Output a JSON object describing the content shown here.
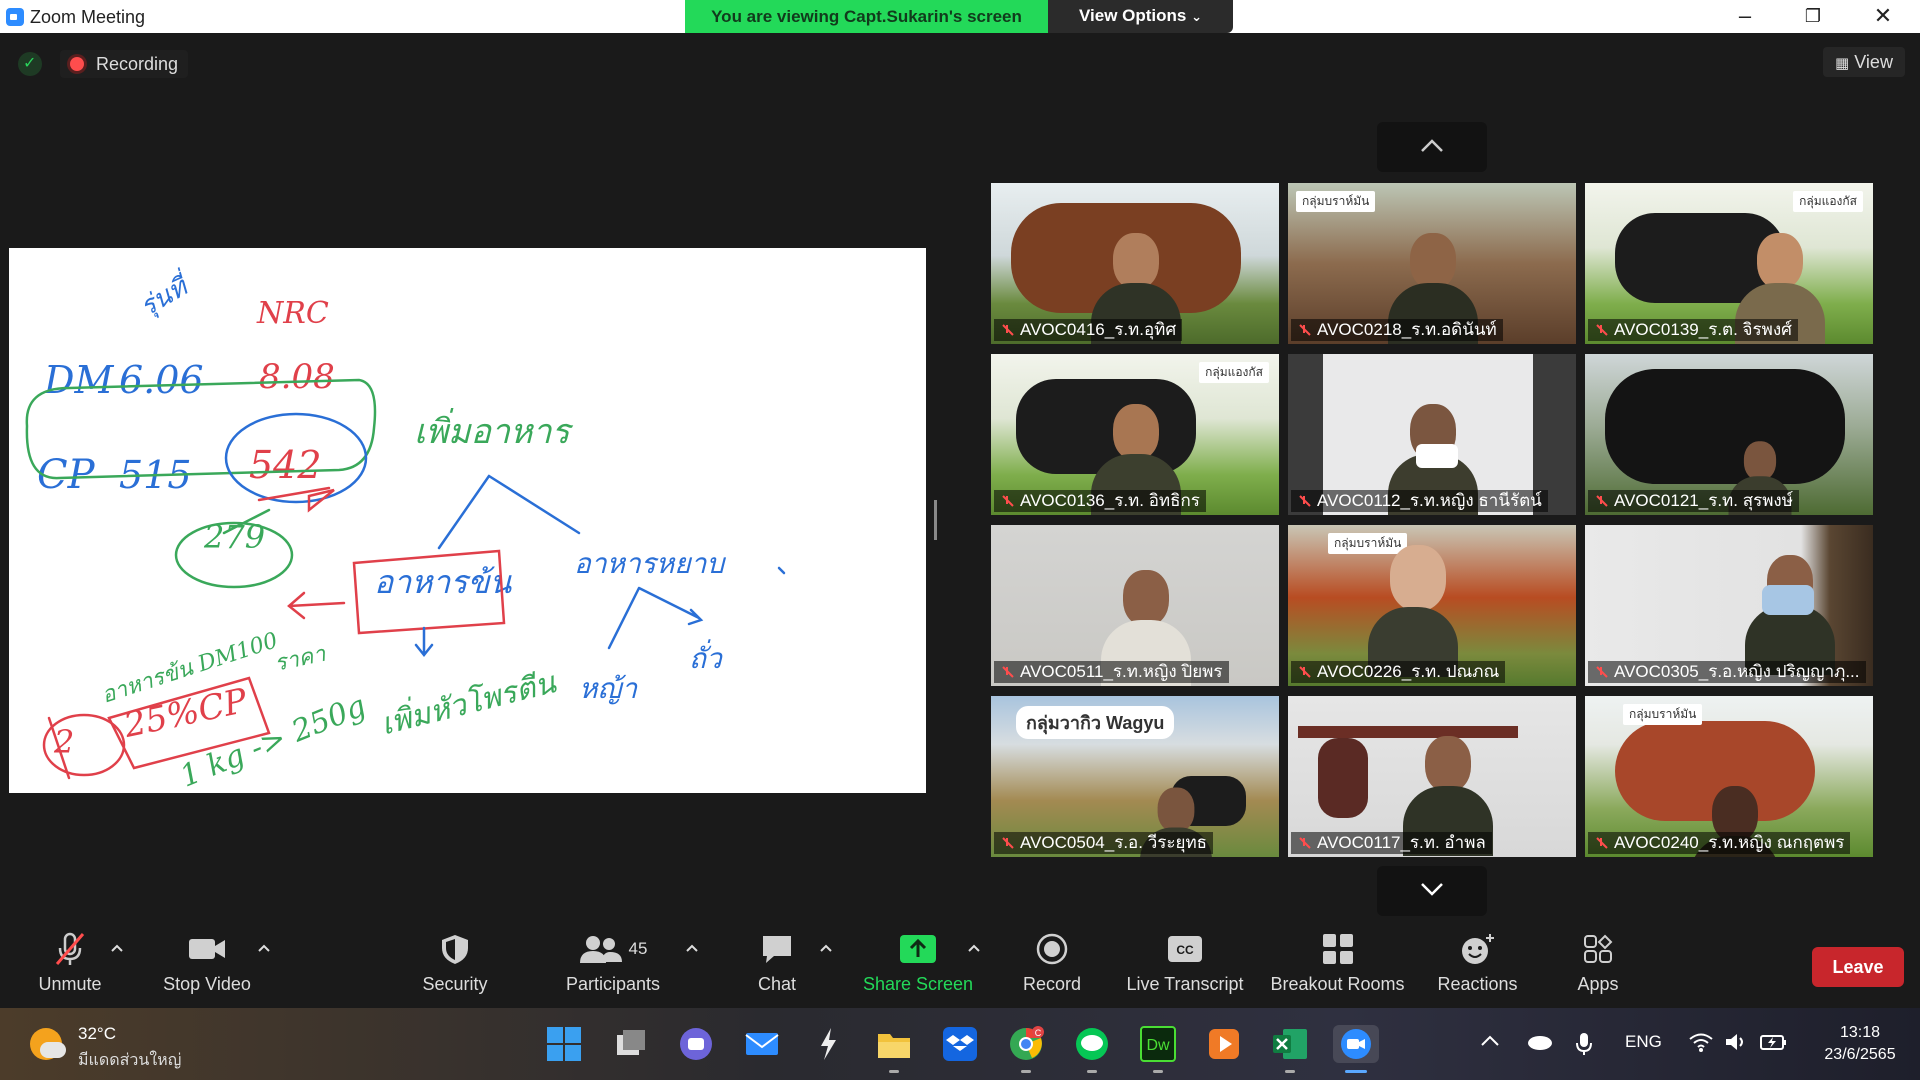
{
  "window": {
    "title": "Zoom Meeting"
  },
  "share_banner": {
    "text": "You are viewing Capt.Sukarin's screen",
    "view_options": "View Options"
  },
  "overlay": {
    "recording": "Recording",
    "view": "View"
  },
  "whiteboard": {
    "lines": [
      "รุ่นที่",
      "NRC",
      "DM",
      "6.06",
      "8.08",
      "CP",
      "515",
      "542",
      "279",
      "เพิ่มอาหาร",
      "อาหารข้น",
      "อาหารหยาบ",
      "อาหารข้น DM100",
      "25%CP",
      "ราคา",
      "1 kg -> 250g",
      "เพิ่มหัวโพรตีน",
      "หญ้า",
      "ถั่ว",
      "2"
    ]
  },
  "participants": [
    {
      "name": "AVOC0416_ร.ท.อุทิศ"
    },
    {
      "name": "AVOC0218_ร.ท.อดินันท์"
    },
    {
      "name": "AVOC0139_ร.ต. จิรพงศ์"
    },
    {
      "name": "AVOC0136_ร.ท. อิทธิกร"
    },
    {
      "name": "AVOC0112_ร.ท.หญิง ธานีรัตน์"
    },
    {
      "name": "AVOC0121_ร.ท. สุรพงษ์"
    },
    {
      "name": "AVOC0511_ร.ท.หญิง ปิยพร"
    },
    {
      "name": "AVOC0226_ร.ท. ปณภณ"
    },
    {
      "name": "AVOC0305_ร.อ.หญิง ปริญญาภุ..."
    },
    {
      "name": "AVOC0504_ร.อ. วีระยุทธ"
    },
    {
      "name": "AVOC0117_ร.ท. อำพล"
    },
    {
      "name": "AVOC0240_ร.ท.หญิง ณกฤตพร"
    }
  ],
  "tile_banners": [
    "กลุ่มบราห์มัน",
    "กลุ่มแองกัส",
    "กลุ่มแองกัส",
    "กลุ่มบราห์มัน",
    "กลุ่มวากิว Wagyu",
    "กลุ่มบราห์มัน"
  ],
  "toolbar": {
    "unmute": "Unmute",
    "stop_video": "Stop Video",
    "security": "Security",
    "participants": "Participants",
    "participants_count": "45",
    "chat": "Chat",
    "share_screen": "Share Screen",
    "record": "Record",
    "live_transcript": "Live Transcript",
    "breakout_rooms": "Breakout Rooms",
    "reactions": "Reactions",
    "apps": "Apps",
    "leave": "Leave"
  },
  "taskbar": {
    "temperature": "32°C",
    "condition": "มีแดดส่วนใหญ่",
    "language": "ENG",
    "time": "13:18",
    "date": "23/6/2565",
    "chrome_badge": "C"
  },
  "colors": {
    "share_green": "#23d959",
    "leave_red": "#c8262c",
    "zoom_blue": "#2d8cff"
  }
}
